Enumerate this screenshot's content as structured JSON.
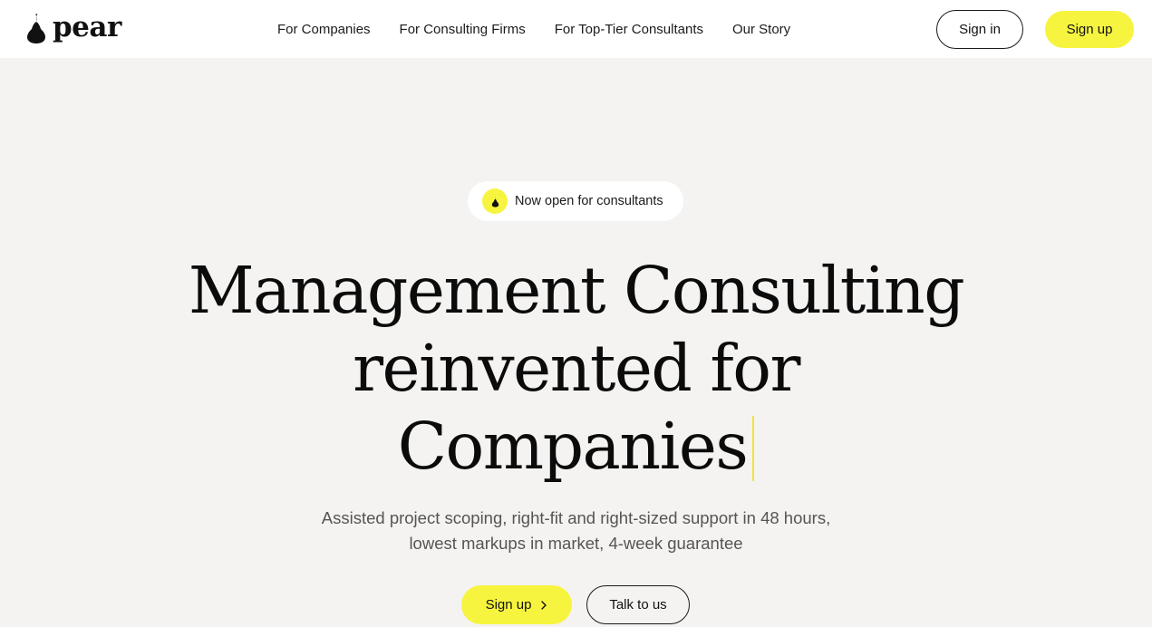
{
  "brand": {
    "name": "pear",
    "icon": "pear-icon",
    "accent_color": "#f7f43f"
  },
  "nav": {
    "items": [
      {
        "label": "For Companies"
      },
      {
        "label": "For Consulting Firms"
      },
      {
        "label": "For Top-Tier Consultants"
      },
      {
        "label": "Our Story"
      }
    ]
  },
  "header": {
    "sign_in_label": "Sign in",
    "sign_up_label": "Sign up"
  },
  "hero": {
    "badge": {
      "icon": "pear-icon",
      "text": "Now open for consultants"
    },
    "headline_lines": [
      "Management Consulting",
      "reinvented for",
      "Companies"
    ],
    "subtitle_lines": [
      "Assisted project scoping, right-fit and right-sized support in 48 hours,",
      "lowest markups in market, 4-week guarantee"
    ],
    "primary_cta": {
      "label": "Sign up",
      "icon": "chevron-right-icon"
    },
    "secondary_cta": {
      "label": "Talk to us"
    }
  }
}
